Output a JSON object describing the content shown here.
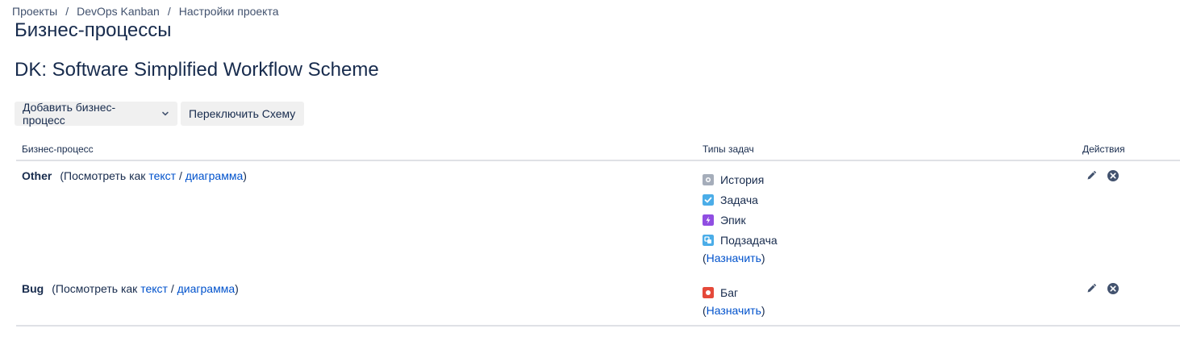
{
  "breadcrumbs": {
    "items": [
      "Проекты",
      "DevOps Kanban",
      "Настройки проекта"
    ],
    "separator": "/"
  },
  "page": {
    "title": "Бизнес-процессы",
    "scheme_title": "DK: Software Simplified Workflow Scheme"
  },
  "toolbar": {
    "add_label": "Добавить бизнес-процесс",
    "switch_label": "Переключить Схему"
  },
  "table": {
    "headers": {
      "workflow": "Бизнес-процесс",
      "issue_types": "Типы задач",
      "actions": "Действия"
    },
    "rows": [
      {
        "name": "Other",
        "view_prefix": "(Посмотреть как",
        "text_link": "текст",
        "slash": "/",
        "diagram_link": "диаграмма",
        "view_suffix": ")",
        "issue_types": [
          {
            "label": "История",
            "icon": "story-icon",
            "color": "#a5adba"
          },
          {
            "label": "Задача",
            "icon": "task-icon",
            "color": "#4bade8"
          },
          {
            "label": "Эпик",
            "icon": "epic-icon",
            "color": "#904ee2"
          },
          {
            "label": "Подзадача",
            "icon": "subtask-icon",
            "color": "#4bade8"
          }
        ],
        "assign_open": "(",
        "assign_link": "Назначить",
        "assign_close": ")"
      },
      {
        "name": "Bug",
        "view_prefix": "(Посмотреть как",
        "text_link": "текст",
        "slash": "/",
        "diagram_link": "диаграмма",
        "view_suffix": ")",
        "issue_types": [
          {
            "label": "Баг",
            "icon": "bug-icon",
            "color": "#e5493a"
          }
        ],
        "assign_open": "(",
        "assign_link": "Назначить",
        "assign_close": ")"
      }
    ]
  },
  "colors": {
    "link": "#0052cc",
    "text": "#172b4d",
    "button_bg": "#f0f0f0",
    "border": "#dfe1e6"
  }
}
